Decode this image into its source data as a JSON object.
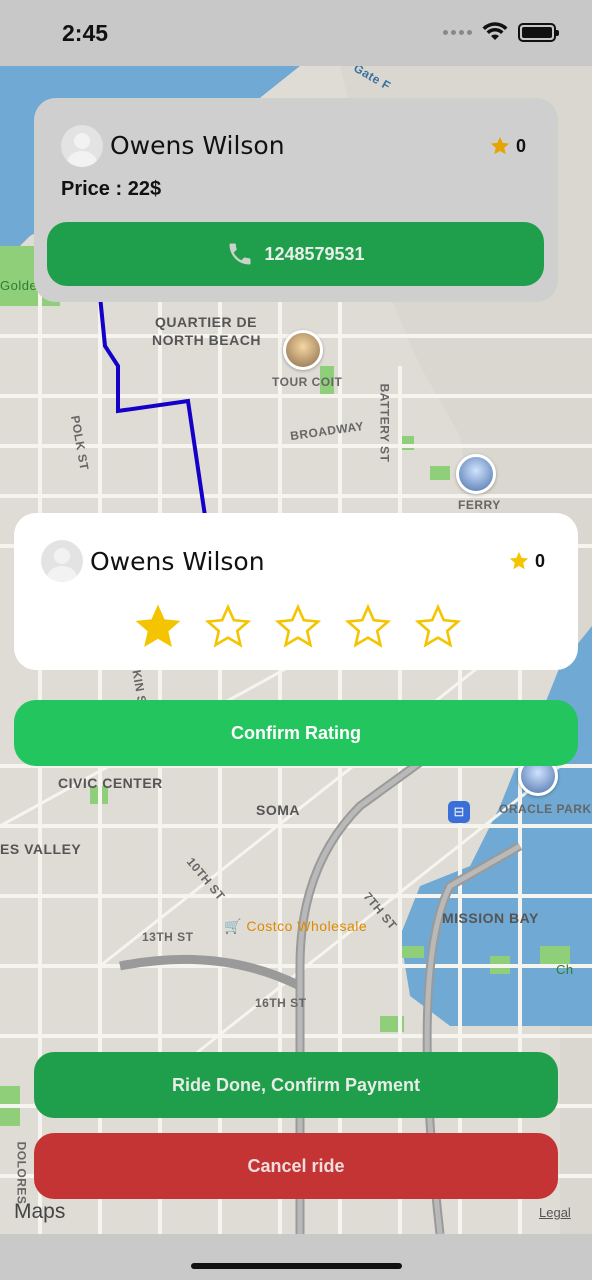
{
  "status_bar": {
    "time": "2:45"
  },
  "map": {
    "labels": {
      "golden_gate": "Golden Gate National Recreation Area",
      "quartier": "QUARTIER DE",
      "north_beach": "NORTH BEACH",
      "tour_coit": "TOUR COIT",
      "broadway": "BROADWAY",
      "battery_st": "BATTERY ST",
      "polk_st": "POLK ST",
      "ferry": "FERRY",
      "civic_center": "CIVIC CENTER",
      "soma": "SOMA",
      "oracle_park": "ORACLE PARK",
      "es_valley": "ES VALLEY",
      "tenth_st": "10TH ST",
      "seventh_st": "7TH ST",
      "costco": "Costco Wholesale",
      "mission_bay": "MISSION BAY",
      "thirteenth_st": "13TH ST",
      "sixteenth_st": "16TH ST",
      "dolores": "DOLORES",
      "ch": "Ch",
      "kin": "KIN S",
      "gate_f": "Gate F",
      "gold": "Gold"
    },
    "logo": "Maps",
    "legal": "Legal",
    "route_color": "#1400c8"
  },
  "driver_card": {
    "name": "Owens Wilson",
    "rating": "0",
    "price": "Price : 22$",
    "phone": "1248579531"
  },
  "rating_card": {
    "name": "Owens Wilson",
    "rating": "0",
    "selected_stars": 1,
    "total_stars": 5
  },
  "buttons": {
    "confirm_rating": "Confirm Rating",
    "ride_done": "Ride Done, Confirm Payment",
    "cancel_ride": "Cancel ride"
  },
  "colors": {
    "green_primary": "#1f9e4b",
    "green_bright": "#22c55e",
    "red": "#c53434",
    "star_gold": "#f5c400"
  }
}
